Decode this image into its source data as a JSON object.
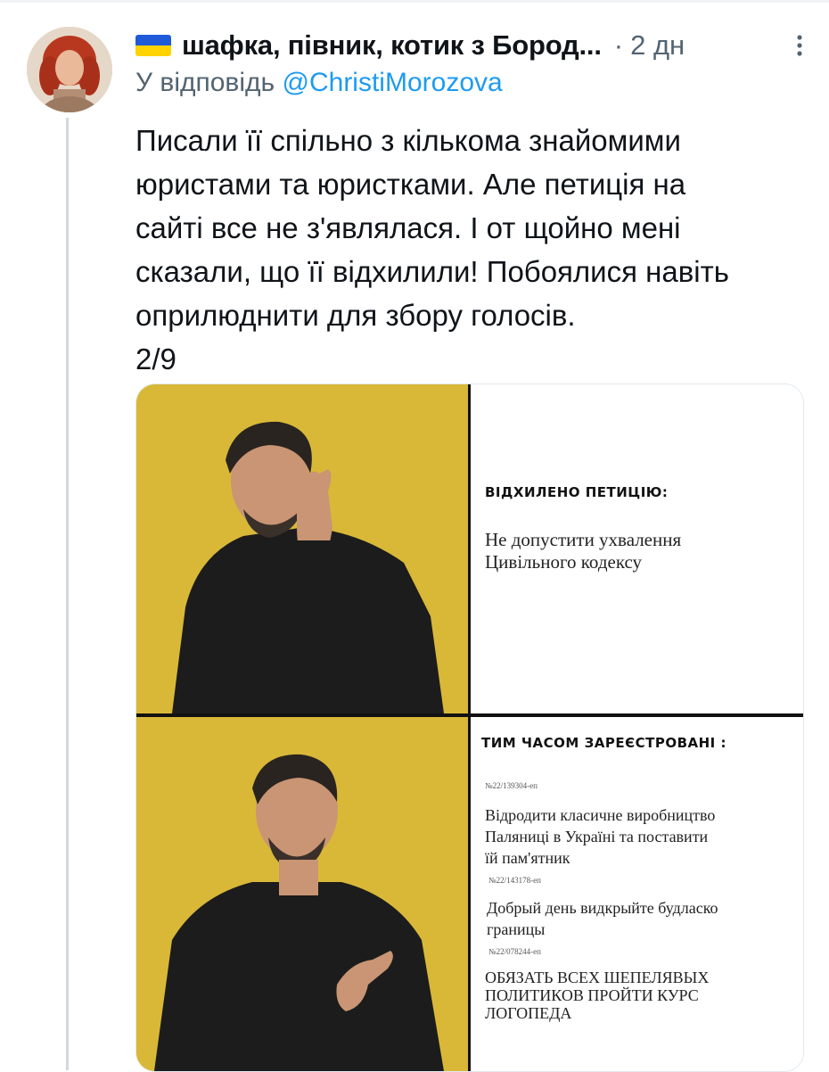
{
  "tweet": {
    "display_name": "шафка, півник, котик з Бород...",
    "separator": "·",
    "time": "2 дн",
    "reply_prefix": "У відповідь ",
    "reply_handle": "@ChristiMorozova",
    "text_lines": [
      "Писали її спільно з кількома знайомими",
      "юристами та юристками. Але петиція на",
      "сайті все не з'являлася. І от щойно мені",
      "сказали, що її відхилили! Побоялися навіть",
      "оприлюднити для збору голосів.",
      "2/9"
    ]
  },
  "meme": {
    "top_title": "ВІДХИЛЕНО ПЕТИЦІЮ:",
    "top_text_lines": [
      "Не допустити ухвалення",
      "Цивільного кодексу"
    ],
    "bottom_title": "ТИМ ЧАСОМ ЗАРЕЄСТРОВАНІ :",
    "petitions": [
      {
        "number": "№22/139304-еп",
        "lines": [
          "Відродити класичне виробництво",
          "Паляниці в Україні та поставити",
          "їй пам'ятник"
        ]
      },
      {
        "number": "№22/143178-еп",
        "lines": [
          "Добрый день видкрыйте будласко",
          "границы"
        ]
      },
      {
        "number": "№22/078244-еп",
        "lines": [
          "ОБЯЗАТЬ ВСЕХ ШЕПЕЛЯВЫХ",
          "ПОЛИТИКОВ ПРОЙТИ КУРС",
          "ЛОГОПЕДА"
        ]
      }
    ]
  },
  "colors": {
    "meme_yellow": "#d9b838",
    "link_blue": "#1d9bf0",
    "meta_gray": "#536471",
    "flag_blue": "#1f5bd8",
    "flag_yellow": "#ffd200"
  },
  "icons": [
    "ukraine-flag-icon",
    "more-options-icon"
  ]
}
